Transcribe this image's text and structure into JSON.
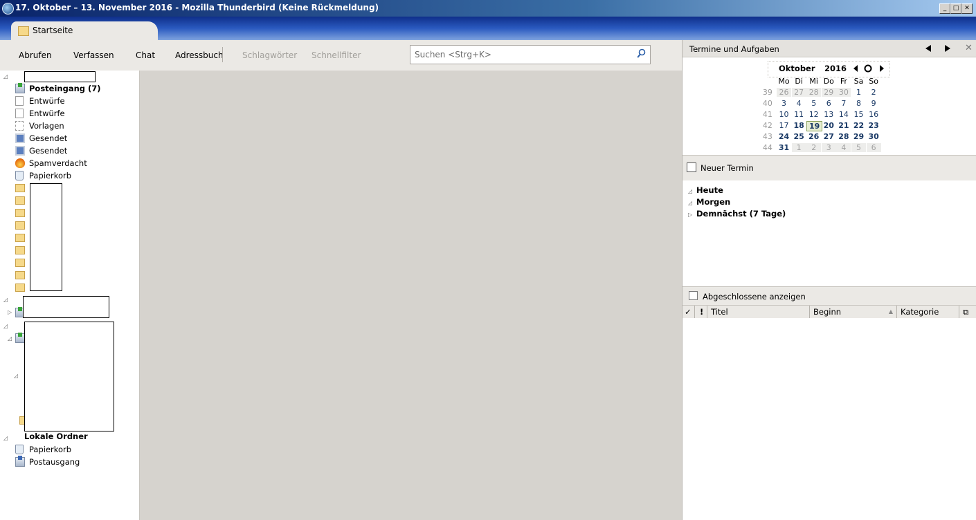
{
  "window": {
    "title": "17. Oktober – 13. November 2016 - Mozilla Thunderbird (Keine Rückmeldung)",
    "buttons": [
      "minimize-icon",
      "maximize-icon",
      "close-icon"
    ]
  },
  "tabs": [
    {
      "label": "Startseite",
      "icon": "folder-icon"
    }
  ],
  "toolbar": {
    "abrufen": "Abrufen",
    "verfassen": "Verfassen",
    "chat": "Chat",
    "adressbuch": "Adressbuch",
    "schlagwoerter": "Schlagwörter",
    "schnellfilter": "Schnellfilter"
  },
  "search": {
    "placeholder": "Suchen <Strg+K>",
    "icon": "search-icon"
  },
  "folders": {
    "account1": {
      "items": [
        {
          "label": "Posteingang (7)",
          "icon": "inbox-icon",
          "bold": true
        },
        {
          "label": "Entwürfe",
          "icon": "drafts-icon"
        },
        {
          "label": "Entwürfe",
          "icon": "drafts-icon"
        },
        {
          "label": "Vorlagen",
          "icon": "templates-icon"
        },
        {
          "label": "Gesendet",
          "icon": "sent-icon"
        },
        {
          "label": "Gesendet",
          "icon": "sent-icon"
        },
        {
          "label": "Spamverdacht",
          "icon": "spam-icon"
        },
        {
          "label": "Papierkorb",
          "icon": "trash-icon"
        }
      ]
    },
    "local": {
      "label": "Lokale Ordner",
      "items": [
        {
          "label": "Papierkorb",
          "icon": "trash-icon"
        },
        {
          "label": "Postausgang",
          "icon": "outbox-icon"
        }
      ]
    }
  },
  "today_pane": {
    "title": "Termine und Aufgaben",
    "calendar": {
      "month": "Oktober",
      "year": "2016",
      "weekdays": [
        "Mo",
        "Di",
        "Mi",
        "Do",
        "Fr",
        "Sa",
        "So"
      ],
      "weeks": [
        {
          "wk": "39",
          "days": [
            "26",
            "27",
            "28",
            "29",
            "30",
            "1",
            "2"
          ]
        },
        {
          "wk": "40",
          "days": [
            "3",
            "4",
            "5",
            "6",
            "7",
            "8",
            "9"
          ]
        },
        {
          "wk": "41",
          "days": [
            "10",
            "11",
            "12",
            "13",
            "14",
            "15",
            "16"
          ]
        },
        {
          "wk": "42",
          "days": [
            "17",
            "18",
            "19",
            "20",
            "21",
            "22",
            "23"
          ]
        },
        {
          "wk": "43",
          "days": [
            "24",
            "25",
            "26",
            "27",
            "28",
            "29",
            "30"
          ]
        },
        {
          "wk": "44",
          "days": [
            "31",
            "1",
            "2",
            "3",
            "4",
            "5",
            "6"
          ]
        }
      ],
      "today": "19"
    },
    "new_event": "Neuer Termin",
    "agenda": [
      {
        "label": "Heute",
        "expanded": true
      },
      {
        "label": "Morgen",
        "expanded": true
      },
      {
        "label": "Demnächst (7 Tage)",
        "expanded": false
      }
    ],
    "tasks": {
      "show_completed": "Abgeschlossene anzeigen",
      "columns": [
        "Titel",
        "Beginn",
        "Kategorie"
      ]
    }
  }
}
